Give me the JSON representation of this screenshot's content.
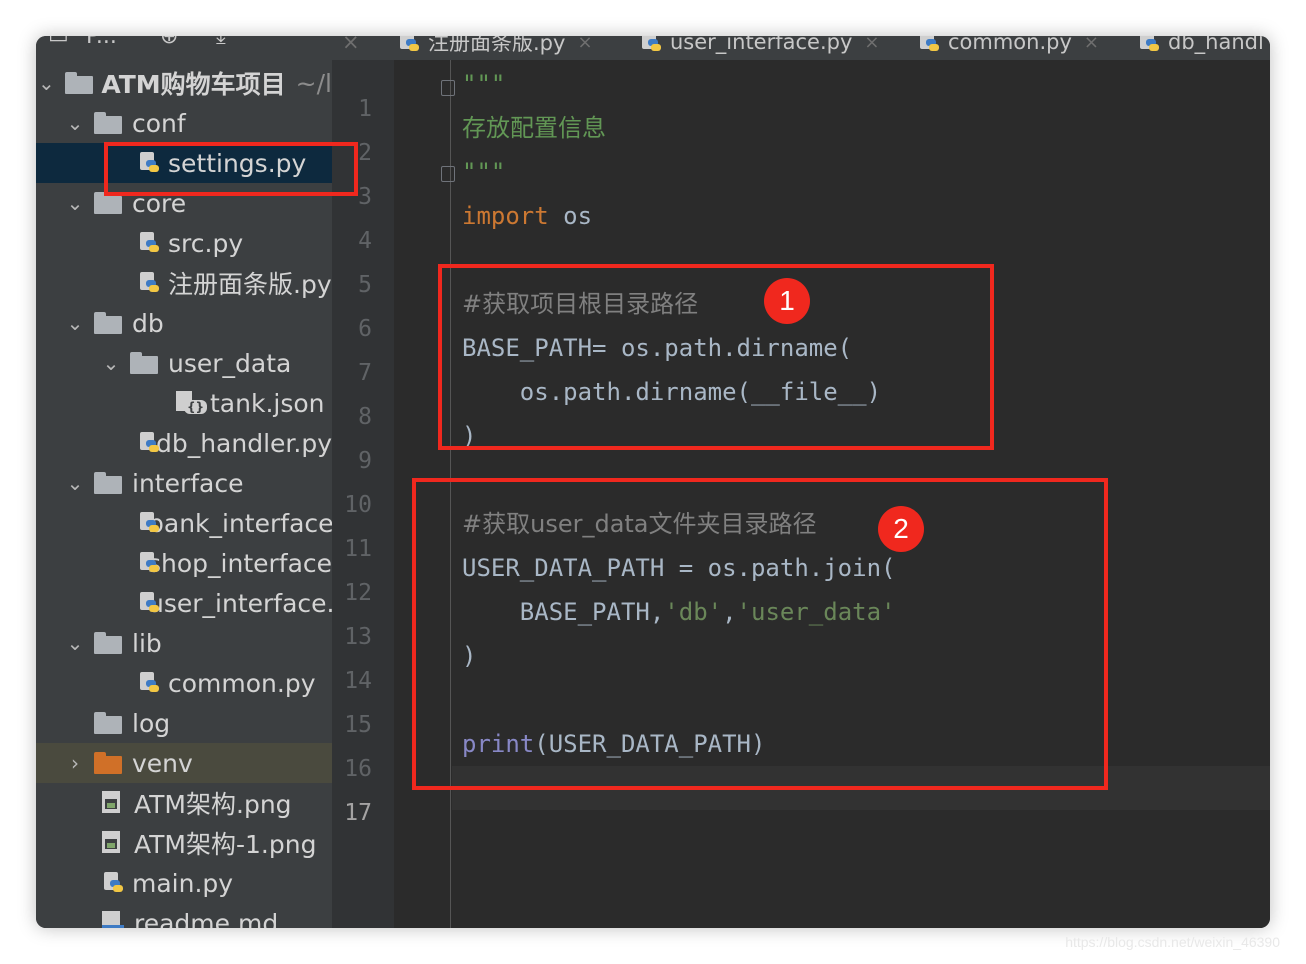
{
  "toolbar": {
    "project_label": "P...",
    "icons": [
      "target-icon",
      "collapse-icon",
      "expand-icon"
    ]
  },
  "tabs": [
    {
      "label": "注册面条版.py",
      "close": "×"
    },
    {
      "label": "user_interface.py",
      "close": "×"
    },
    {
      "label": "common.py",
      "close": "×"
    },
    {
      "label": "db_handl",
      "close": ""
    }
  ],
  "tree": [
    {
      "label": "ATM购物车项目",
      "suffix": "~/l"
    },
    {
      "label": "conf"
    },
    {
      "label": "settings.py"
    },
    {
      "label": "core"
    },
    {
      "label": "src.py"
    },
    {
      "label": "注册面条版.py"
    },
    {
      "label": "db"
    },
    {
      "label": "user_data"
    },
    {
      "label": "tank.json"
    },
    {
      "label": "db_handler.py"
    },
    {
      "label": "interface"
    },
    {
      "label": "bank_interface.py"
    },
    {
      "label": "shop_interface.py"
    },
    {
      "label": "user_interface.py"
    },
    {
      "label": "lib"
    },
    {
      "label": "common.py"
    },
    {
      "label": "log"
    },
    {
      "label": "venv"
    },
    {
      "label": "ATM架构.png"
    },
    {
      "label": "ATM架构-1.png"
    },
    {
      "label": "main.py"
    },
    {
      "label": "readme.md"
    }
  ],
  "line_numbers": [
    "1",
    "2",
    "3",
    "4",
    "5",
    "6",
    "7",
    "8",
    "9",
    "10",
    "11",
    "12",
    "13",
    "14",
    "15",
    "16",
    "17"
  ],
  "code": {
    "l1": "\"\"\"",
    "l2": "存放配置信息",
    "l3": "\"\"\"",
    "l4_kw": "import",
    "l4_rest": " os",
    "l6": "#获取项目根目录路径",
    "l7": "BASE_PATH= os.path.dirname(",
    "l8": "    os.path.dirname(__file__)",
    "l9": ")",
    "l11": "#获取user_data文件夹目录路径",
    "l12": "USER_DATA_PATH = os.path.join(",
    "l13_a": "    BASE_PATH,",
    "l13_b": "'db'",
    "l13_c": ",",
    "l13_d": "'user_data'",
    "l14": ")",
    "l16_fn": "print",
    "l16_rest": "(USER_DATA_PATH)"
  },
  "annotations": {
    "badge1": "1",
    "badge2": "2",
    "highlight_color": "#f0281e"
  },
  "watermark": "https://blog.csdn.net/weixin_46390"
}
